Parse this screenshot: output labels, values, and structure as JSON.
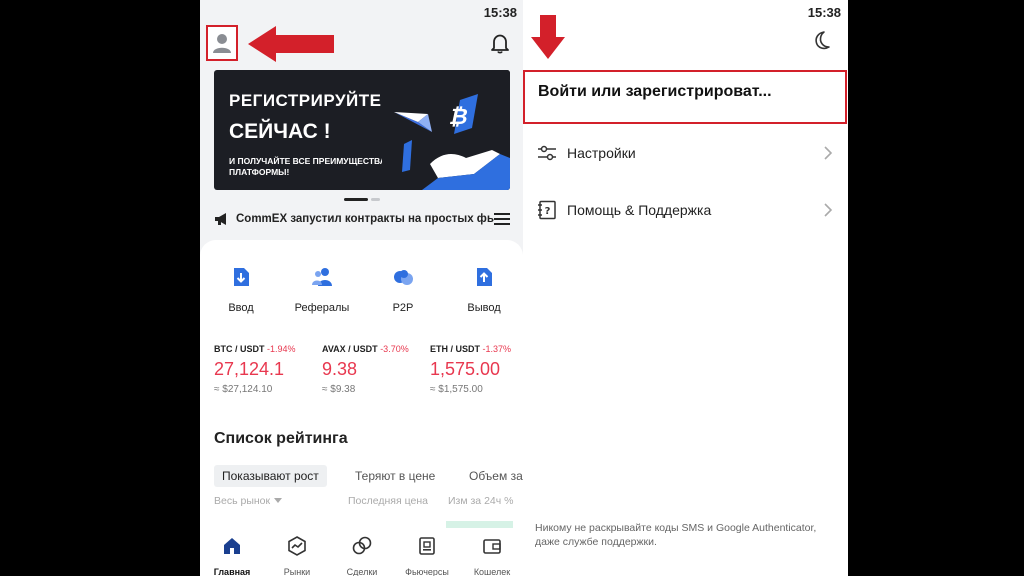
{
  "status_bar": {
    "time": "15:38"
  },
  "left": {
    "banner": {
      "line1": "РЕГИСТРИРУЙТЕСЬ",
      "line2": "СЕЙЧАС !",
      "line3": "И ПОЛУЧАЙТЕ ВСЕ ПРЕИМУЩЕСТВА ПЛАТФОРМЫ!"
    },
    "news": "CommEX запустил контракты на простых фьюче",
    "quick_actions": [
      {
        "label": "Ввод",
        "icon": "deposit-icon"
      },
      {
        "label": "Рефералы",
        "icon": "referral-icon"
      },
      {
        "label": "P2P",
        "icon": "p2p-icon"
      },
      {
        "label": "Вывод",
        "icon": "withdraw-icon"
      }
    ],
    "tickers": [
      {
        "pair": "BTC / USDT",
        "change": "-1.94%",
        "price": "27,124.1",
        "approx": "≈ $27,124.10"
      },
      {
        "pair": "AVAX / USDT",
        "change": "-3.70%",
        "price": "9.38",
        "approx": "≈ $9.38"
      },
      {
        "pair": "ETH / USDT",
        "change": "-1.37%",
        "price": "1,575.00",
        "approx": "≈ $1,575.00"
      }
    ],
    "ranking": {
      "title": "Список рейтинга",
      "filters": [
        "Показывают рост",
        "Теряют в цене",
        "Объем за"
      ],
      "market": "Весь рынок",
      "col_price": "Последняя цена",
      "col_change": "Изм за 24ч %"
    },
    "tabs": [
      {
        "label": "Главная",
        "icon": "home-icon"
      },
      {
        "label": "Рынки",
        "icon": "markets-icon"
      },
      {
        "label": "Сделки",
        "icon": "trades-icon"
      },
      {
        "label": "Фьючерсы",
        "icon": "futures-icon"
      },
      {
        "label": "Кошелек",
        "icon": "wallet-icon"
      }
    ]
  },
  "right": {
    "login": "Войти или зарегистрироват...",
    "menu": [
      {
        "label": "Настройки",
        "icon": "settings-sliders-icon"
      },
      {
        "label": "Помощь & Поддержка",
        "icon": "help-icon"
      }
    ],
    "disclaimer": "Никому не раскрывайте коды SMS и Google Authenticator, даже службе поддержки."
  },
  "colors": {
    "annotation_red": "#d3202a",
    "negative": "#e8384f",
    "brand_blue": "#2f6fdf",
    "banner_bg": "#1c1e24"
  }
}
